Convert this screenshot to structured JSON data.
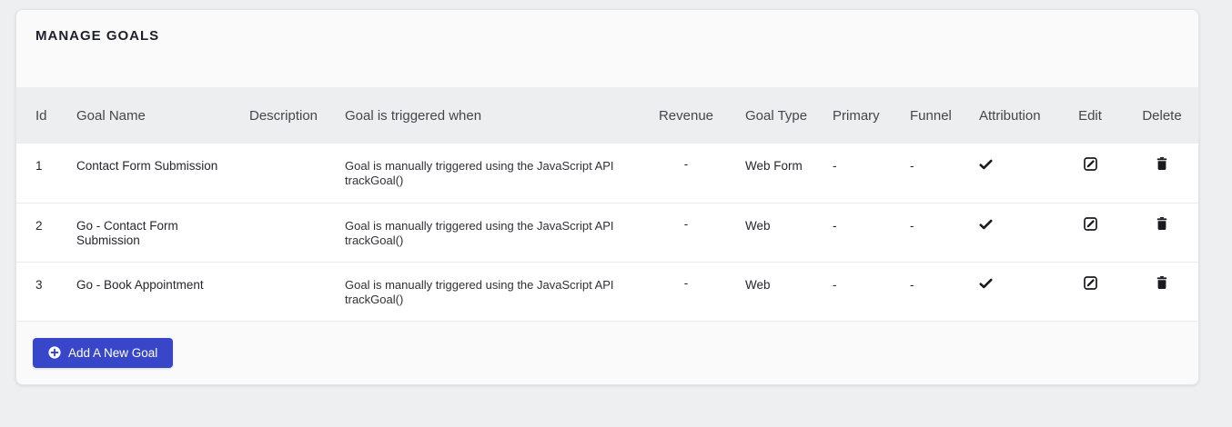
{
  "card": {
    "title": "MANAGE GOALS"
  },
  "table": {
    "headers": [
      "Id",
      "Goal Name",
      "Description",
      "Goal is triggered when",
      "Revenue",
      "Goal Type",
      "Primary",
      "Funnel",
      "Attribution",
      "Edit",
      "Delete"
    ],
    "rows": [
      {
        "id": "1",
        "name": "Contact Form Submission",
        "description": "",
        "trigger": "Goal is manually triggered using the JavaScript API trackGoal()",
        "revenue": "-",
        "goal_type": "Web Form",
        "primary": "-",
        "funnel": "-",
        "attribution": "checked"
      },
      {
        "id": "2",
        "name": "Go - Contact Form Submission",
        "description": "",
        "trigger": "Goal is manually triggered using the JavaScript API trackGoal()",
        "revenue": "-",
        "goal_type": "Web",
        "primary": "-",
        "funnel": "-",
        "attribution": "checked"
      },
      {
        "id": "3",
        "name": "Go - Book Appointment",
        "description": "",
        "trigger": "Goal is manually triggered using the JavaScript API trackGoal()",
        "revenue": "-",
        "goal_type": "Web",
        "primary": "-",
        "funnel": "-",
        "attribution": "checked"
      }
    ]
  },
  "actions": {
    "add_goal_label": "Add A New Goal"
  },
  "colors": {
    "accent": "#3847c9",
    "header_band": "#edeef0",
    "card_bg": "#fafafb",
    "page_bg": "#edeff1",
    "icon": "#1b1b1f"
  },
  "icons": {
    "attribution": "check-icon",
    "edit": "edit-square-icon",
    "delete": "trash-icon",
    "add": "plus-circle-icon"
  }
}
